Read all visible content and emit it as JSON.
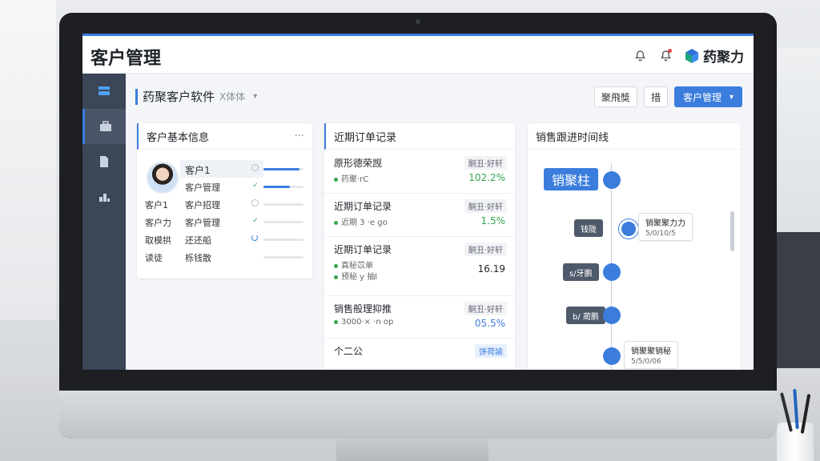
{
  "app": {
    "title": "客户管理",
    "brand": "药聚力"
  },
  "sidebar": {
    "items": [
      {
        "icon": "layers-icon"
      },
      {
        "icon": "briefcase-icon"
      },
      {
        "icon": "document-icon"
      },
      {
        "icon": "chart-icon"
      }
    ]
  },
  "subheader": {
    "title": "药聚客户软件",
    "muted": "X体体"
  },
  "toolbar": {
    "btn1": "聚飛獎",
    "btn2": "措",
    "primary": "客户管理"
  },
  "card_info": {
    "title": "客户基本信息",
    "more": "···",
    "rows": [
      {
        "key": "",
        "value": "客户1",
        "status": "pending",
        "progress": 0.9
      },
      {
        "key": "",
        "value": "客户管理",
        "status": "done",
        "progress": 0.65
      },
      {
        "key": "客户1",
        "value": "客户招理",
        "status": "pending",
        "progress": 0
      },
      {
        "key": "客户力",
        "value": "客户管理",
        "status": "done",
        "progress": 0
      },
      {
        "key": "取模拱",
        "value": "还还船",
        "status": "loading",
        "progress": 0
      },
      {
        "key": "读徒",
        "value": "栎钱散",
        "status": "",
        "progress": 0
      }
    ]
  },
  "card_orders": {
    "title": "近期订单记录",
    "items": [
      {
        "title": "原形德荣觊",
        "tag": "酮丑·好轩",
        "sub": "药聚·rC",
        "value": "102.2%",
        "value_color": "#36a552"
      },
      {
        "title": "近期订单记录",
        "tag": "酮丑·好轩",
        "sub": "近期 3 ·e go",
        "value": "1.5%",
        "value_color": "#36a552"
      },
      {
        "title": "近期订单记录",
        "tag": "酮丑·好轩",
        "sub": "真秘苡单",
        "sub2": "预秘 y 抽l",
        "value": "16.19",
        "value_color": "#1f2329"
      },
      {
        "title": "销售般理抑推",
        "tag": "酮丑·好轩",
        "sub": "3000·× ·n op",
        "value": "05.5%",
        "value_color": "#3b7ddd"
      },
      {
        "title": "个二公",
        "tag": "饼荷諭",
        "sub": "",
        "value": "",
        "value_color": "#1f2329"
      }
    ]
  },
  "card_timeline": {
    "title": "销售跟进时间线",
    "big_label": "销聚柱",
    "labels": [
      "钱陇",
      "s/牙鹏",
      "b/ 蔺鹏"
    ],
    "boxes": [
      {
        "title": "销聚聚力力",
        "meta": "5/0/10/5"
      },
      {
        "title": "销聚聚销秘",
        "meta": "5/5/0/06"
      }
    ]
  }
}
